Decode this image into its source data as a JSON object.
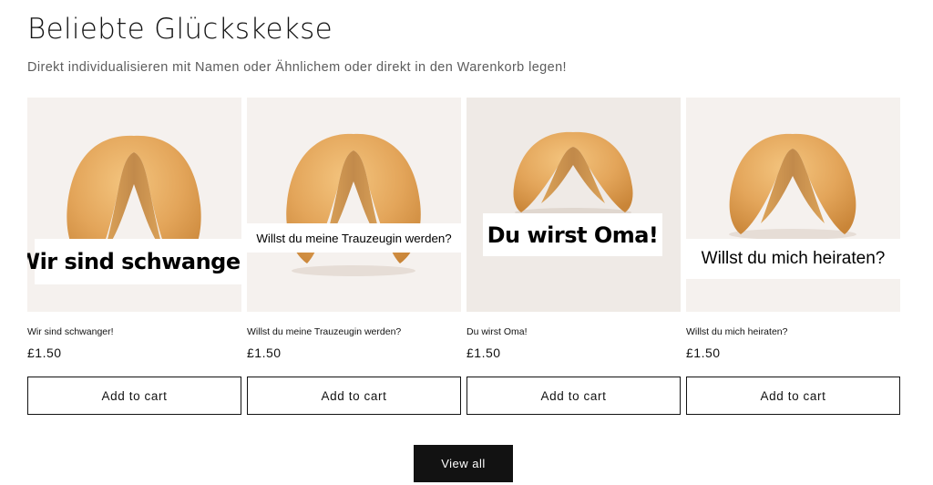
{
  "section": {
    "title": "Beliebte Glückskekse",
    "subtitle": "Direkt individualisieren mit Namen oder Ähnlichem oder direkt in den Warenkorb legen!"
  },
  "products": [
    {
      "title": "Wir sind schwanger!",
      "image_text": "Wir sind schwanger!",
      "price": "£1.50",
      "button": "Add to cart"
    },
    {
      "title": "Willst du meine Trauzeugin werden?",
      "image_text": "Willst du meine Trauzeugin werden?",
      "price": "£1.50",
      "button": "Add to cart"
    },
    {
      "title": "Du wirst Oma!",
      "image_text": "Du wirst Oma!",
      "price": "£1.50",
      "button": "Add to cart"
    },
    {
      "title": "Willst du mich heiraten?",
      "image_text": "Willst du mich heiraten?",
      "price": "£1.50",
      "button": "Add to cart"
    }
  ],
  "view_all_label": "View all",
  "colors": {
    "button_dark": "#121212",
    "image_background": "#f5f1ee",
    "cookie": "#e3a55a"
  }
}
